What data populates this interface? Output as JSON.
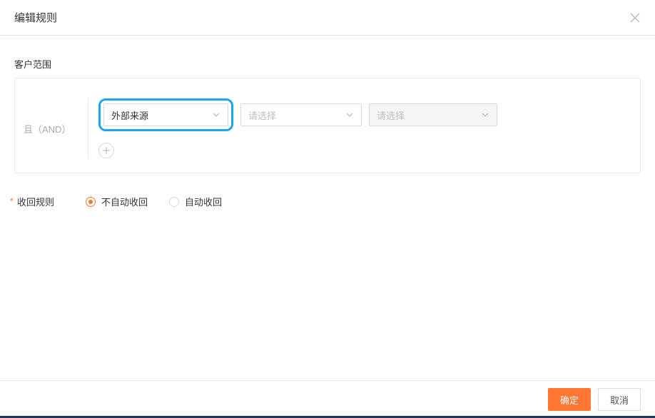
{
  "header": {
    "title": "编辑规则"
  },
  "scope": {
    "label": "客户范围",
    "and_label": "且（AND）",
    "selects": {
      "source": {
        "value": "外部来源"
      },
      "middle": {
        "placeholder": "请选择"
      },
      "right": {
        "placeholder": "请选择"
      }
    }
  },
  "recall": {
    "label": "收回规则",
    "options": {
      "no_auto": {
        "label": "不自动收回",
        "checked": true
      },
      "auto": {
        "label": "自动收回",
        "checked": false
      }
    }
  },
  "footer": {
    "confirm": "确定",
    "cancel": "取消"
  }
}
